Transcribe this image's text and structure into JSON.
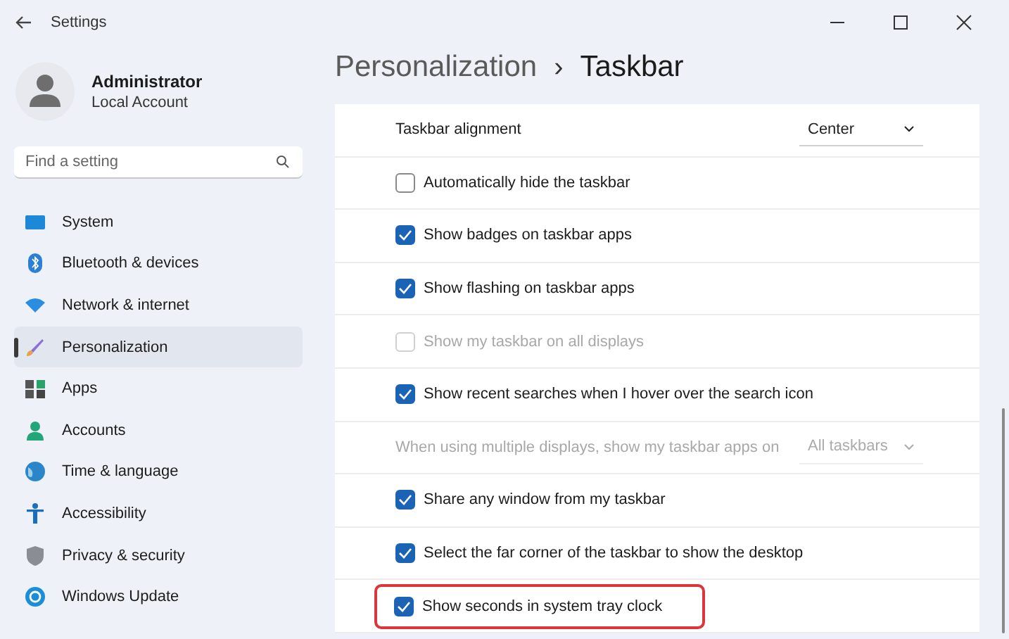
{
  "window": {
    "title": "Settings"
  },
  "account": {
    "name": "Administrator",
    "type": "Local Account"
  },
  "search": {
    "placeholder": "Find a setting"
  },
  "sidebar": {
    "items": [
      {
        "label": "System",
        "selected": false
      },
      {
        "label": "Bluetooth & devices",
        "selected": false
      },
      {
        "label": "Network & internet",
        "selected": false
      },
      {
        "label": "Personalization",
        "selected": true
      },
      {
        "label": "Apps",
        "selected": false
      },
      {
        "label": "Accounts",
        "selected": false
      },
      {
        "label": "Time & language",
        "selected": false
      },
      {
        "label": "Accessibility",
        "selected": false
      },
      {
        "label": "Privacy & security",
        "selected": false
      },
      {
        "label": "Windows Update",
        "selected": false
      }
    ]
  },
  "breadcrumb": {
    "parent": "Personalization",
    "separator": "›",
    "current": "Taskbar"
  },
  "settings": [
    {
      "kind": "dropdown",
      "label": "Taskbar alignment",
      "value": "Center",
      "disabled": false
    },
    {
      "kind": "checkbox",
      "label": "Automatically hide the taskbar",
      "checked": false,
      "disabled": false,
      "highlighted": false
    },
    {
      "kind": "checkbox",
      "label": "Show badges on taskbar apps",
      "checked": true,
      "disabled": false,
      "highlighted": false
    },
    {
      "kind": "checkbox",
      "label": "Show flashing on taskbar apps",
      "checked": true,
      "disabled": false,
      "highlighted": false
    },
    {
      "kind": "checkbox",
      "label": "Show my taskbar on all displays",
      "checked": false,
      "disabled": true,
      "highlighted": false
    },
    {
      "kind": "checkbox",
      "label": "Show recent searches when I hover over the search icon",
      "checked": true,
      "disabled": false,
      "highlighted": false
    },
    {
      "kind": "dropdown",
      "label": "When using multiple displays, show my taskbar apps on",
      "value": "All taskbars",
      "disabled": true
    },
    {
      "kind": "checkbox",
      "label": "Share any window from my taskbar",
      "checked": true,
      "disabled": false,
      "highlighted": false
    },
    {
      "kind": "checkbox",
      "label": "Select the far corner of the taskbar to show the desktop",
      "checked": true,
      "disabled": false,
      "highlighted": false
    },
    {
      "kind": "checkbox",
      "label": "Show seconds in system tray clock",
      "checked": true,
      "disabled": false,
      "highlighted": true
    }
  ]
}
